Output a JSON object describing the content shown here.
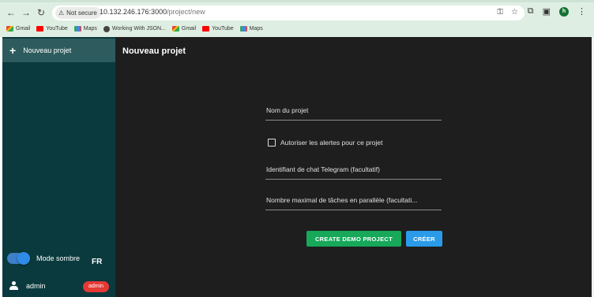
{
  "browser": {
    "security_label": "Not secure",
    "url_host": "10.132.246.176:3000",
    "url_path": "/project/new",
    "profile_initial": "h",
    "bookmarks": [
      {
        "label": "Gmail",
        "icon": "gmail-icon"
      },
      {
        "label": "YouTube",
        "icon": "youtube-icon"
      },
      {
        "label": "Maps",
        "icon": "maps-icon"
      },
      {
        "label": "Working With JSON...",
        "icon": "globe-icon"
      },
      {
        "label": "Gmail",
        "icon": "gmail-icon"
      },
      {
        "label": "YouTube",
        "icon": "youtube-icon"
      },
      {
        "label": "Maps",
        "icon": "maps-icon"
      }
    ]
  },
  "sidebar": {
    "new_project_label": "Nouveau projet",
    "dark_mode_label": "Mode sombre",
    "dark_mode_on": true,
    "language": "FR",
    "user_name": "admin",
    "user_badge": "admin"
  },
  "main": {
    "title": "Nouveau projet",
    "fields": {
      "project_name": "Nom du projet",
      "allow_alerts": "Autoriser les alertes pour ce projet",
      "telegram_chat_id": "Identifiant de chat Telegram (facultatif)",
      "max_parallel_tasks": "Nombre maximal de tâches en parallèle (facultati..."
    },
    "buttons": {
      "demo": "CREATE DEMO PROJECT",
      "create": "CRÉER"
    }
  },
  "colors": {
    "sidebar_bg": "#0a3a3e",
    "main_bg": "#1e1e1e",
    "demo_button": "#17a85a",
    "create_button": "#2a9be8",
    "badge": "#e53935"
  }
}
